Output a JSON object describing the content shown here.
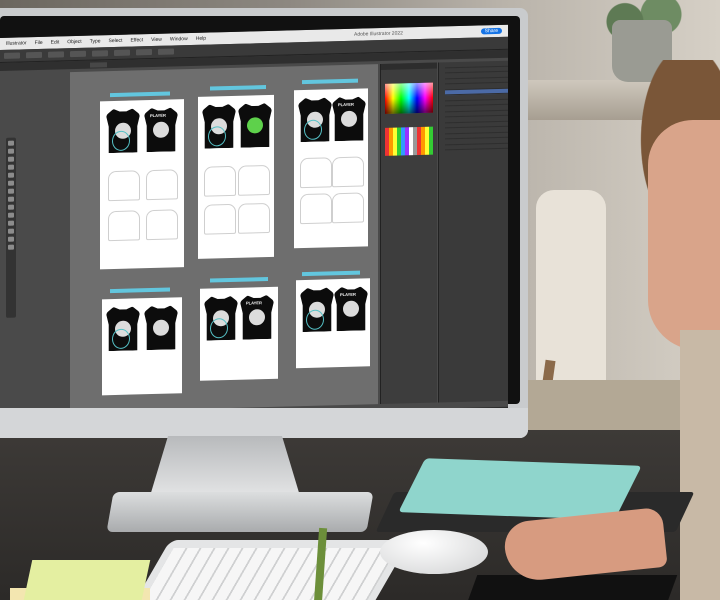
{
  "app": {
    "name": "Illustrator",
    "window_title": "Adobe Illustrator 2022",
    "menus": [
      "Illustrator",
      "File",
      "Edit",
      "Object",
      "Type",
      "Select",
      "Effect",
      "View",
      "Window",
      "Help"
    ],
    "share_label": "Share"
  },
  "artwork": {
    "jersey_text": "PLAYER"
  }
}
